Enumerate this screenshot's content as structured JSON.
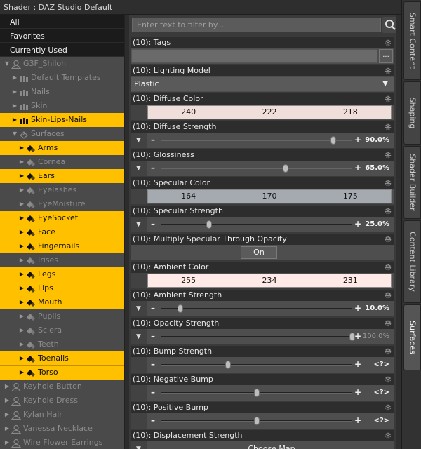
{
  "window": {
    "title": "Shader : DAZ Studio Default"
  },
  "categories": [
    {
      "label": "All"
    },
    {
      "label": "Favorites"
    },
    {
      "label": "Currently Used"
    }
  ],
  "tree": [
    {
      "label": "G3F_Shiloh",
      "depth": 0,
      "expanded": true,
      "highlight": false,
      "icon": "figure-icon"
    },
    {
      "label": "Default Templates",
      "depth": 1,
      "expanded": false,
      "highlight": false,
      "icon": "folder-icon"
    },
    {
      "label": "Nails",
      "depth": 1,
      "expanded": false,
      "highlight": false,
      "icon": "folder-icon"
    },
    {
      "label": "Skin",
      "depth": 1,
      "expanded": false,
      "highlight": false,
      "icon": "folder-icon"
    },
    {
      "label": "Skin-Lips-Nails",
      "depth": 1,
      "expanded": false,
      "highlight": true,
      "icon": "folder-icon"
    },
    {
      "label": "Surfaces",
      "depth": 1,
      "expanded": true,
      "highlight": false,
      "icon": "surfaces-icon"
    },
    {
      "label": "Arms",
      "depth": 2,
      "expanded": false,
      "highlight": true,
      "icon": "surface-icon"
    },
    {
      "label": "Cornea",
      "depth": 2,
      "expanded": false,
      "highlight": false,
      "icon": "surface-icon"
    },
    {
      "label": "Ears",
      "depth": 2,
      "expanded": false,
      "highlight": true,
      "icon": "surface-icon"
    },
    {
      "label": "Eyelashes",
      "depth": 2,
      "expanded": false,
      "highlight": false,
      "icon": "surface-icon"
    },
    {
      "label": "EyeMoisture",
      "depth": 2,
      "expanded": false,
      "highlight": false,
      "icon": "surface-icon"
    },
    {
      "label": "EyeSocket",
      "depth": 2,
      "expanded": false,
      "highlight": true,
      "icon": "surface-icon"
    },
    {
      "label": "Face",
      "depth": 2,
      "expanded": false,
      "highlight": true,
      "icon": "surface-icon"
    },
    {
      "label": "Fingernails",
      "depth": 2,
      "expanded": false,
      "highlight": true,
      "icon": "surface-icon"
    },
    {
      "label": "Irises",
      "depth": 2,
      "expanded": false,
      "highlight": false,
      "icon": "surface-icon"
    },
    {
      "label": "Legs",
      "depth": 2,
      "expanded": false,
      "highlight": true,
      "icon": "surface-icon"
    },
    {
      "label": "Lips",
      "depth": 2,
      "expanded": false,
      "highlight": true,
      "icon": "surface-icon"
    },
    {
      "label": "Mouth",
      "depth": 2,
      "expanded": false,
      "highlight": true,
      "icon": "surface-icon"
    },
    {
      "label": "Pupils",
      "depth": 2,
      "expanded": false,
      "highlight": false,
      "icon": "surface-icon"
    },
    {
      "label": "Sclera",
      "depth": 2,
      "expanded": false,
      "highlight": false,
      "icon": "surface-icon"
    },
    {
      "label": "Teeth",
      "depth": 2,
      "expanded": false,
      "highlight": false,
      "icon": "surface-icon"
    },
    {
      "label": "Toenails",
      "depth": 2,
      "expanded": false,
      "highlight": true,
      "icon": "surface-icon"
    },
    {
      "label": "Torso",
      "depth": 2,
      "expanded": false,
      "highlight": true,
      "icon": "surface-icon"
    },
    {
      "label": "Keyhole Button",
      "depth": 0,
      "expanded": false,
      "highlight": false,
      "icon": "figure-icon"
    },
    {
      "label": "Keyhole Dress",
      "depth": 0,
      "expanded": false,
      "highlight": false,
      "icon": "figure-icon"
    },
    {
      "label": "Kylan Hair",
      "depth": 0,
      "expanded": false,
      "highlight": false,
      "icon": "figure-icon"
    },
    {
      "label": "Vanessa Necklace",
      "depth": 0,
      "expanded": false,
      "highlight": false,
      "icon": "figure-icon"
    },
    {
      "label": "Wire Flower Earrings",
      "depth": 0,
      "expanded": false,
      "highlight": false,
      "icon": "figure-icon"
    }
  ],
  "filter": {
    "placeholder": "Enter text to filter by..."
  },
  "properties": [
    {
      "label": "(10): Tags",
      "kind": "text",
      "button_label": "..."
    },
    {
      "label": "(10): Lighting Model",
      "kind": "select",
      "value": "Plastic"
    },
    {
      "label": "(10): Diffuse Color",
      "kind": "color",
      "rgb": [
        "240",
        "222",
        "218"
      ],
      "color": "#f0deda"
    },
    {
      "label": "(10): Diffuse Strength",
      "kind": "slider",
      "value_text": "90.0%",
      "level": 0.9,
      "dim": false
    },
    {
      "label": "(10): Glossiness",
      "kind": "slider",
      "value_text": "65.0%",
      "level": 0.65,
      "dim": false
    },
    {
      "label": "(10): Specular Color",
      "kind": "color",
      "rgb": [
        "164",
        "170",
        "175"
      ],
      "color": "#a4aaaf"
    },
    {
      "label": "(10): Specular Strength",
      "kind": "slider",
      "value_text": "25.0%",
      "level": 0.25,
      "dim": false
    },
    {
      "label": "(10): Multiply Specular Through Opacity",
      "kind": "toggle",
      "value": "On"
    },
    {
      "label": "(10): Ambient Color",
      "kind": "color",
      "rgb": [
        "255",
        "234",
        "231"
      ],
      "color": "#ffeae7"
    },
    {
      "label": "(10): Ambient Strength",
      "kind": "slider",
      "value_text": "10.0%",
      "level": 0.1,
      "dim": false
    },
    {
      "label": "(10): Opacity Strength",
      "kind": "slider",
      "value_text": "100.0%",
      "level": 1.0,
      "dim": true
    },
    {
      "label": "(10): Bump Strength",
      "kind": "slider_nomap",
      "value_text": "<?>",
      "level": 0.35
    },
    {
      "label": "(10): Negative Bump",
      "kind": "slider_nomap",
      "value_text": "<?>",
      "level": 0.5
    },
    {
      "label": "(10): Positive Bump",
      "kind": "slider_nomap",
      "value_text": "<?>",
      "level": 0.5
    },
    {
      "label": "(10): Displacement Strength",
      "kind": "map",
      "value": "Choose Map"
    }
  ],
  "side_tabs": [
    {
      "label": "Smart Content",
      "active": false
    },
    {
      "label": "Shaping",
      "active": false
    },
    {
      "label": "Shader Builder",
      "active": false
    },
    {
      "label": "Content Library",
      "active": false
    },
    {
      "label": "Surfaces",
      "active": true
    }
  ],
  "colors": {
    "highlight": "#ffc000",
    "panel": "#4a4a4a",
    "dark": "#1b1b1b"
  }
}
